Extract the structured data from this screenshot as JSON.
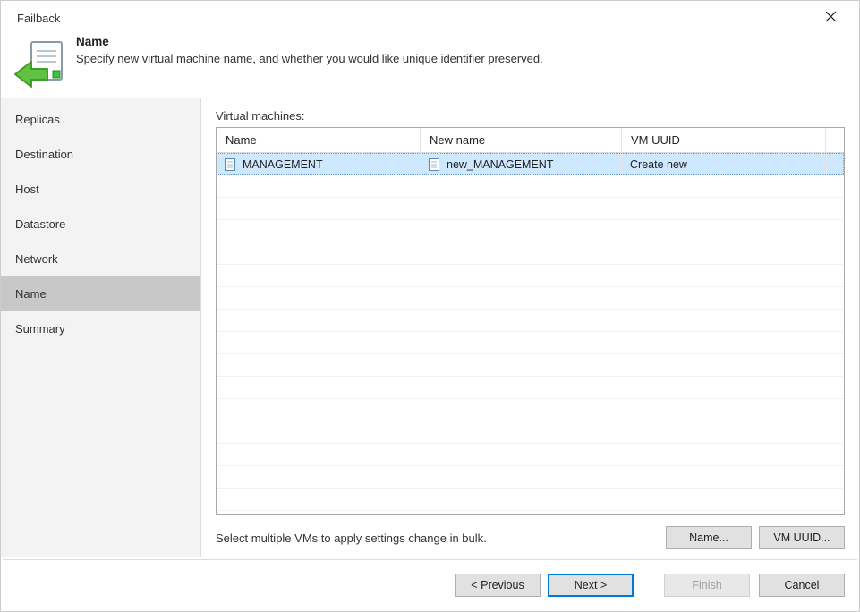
{
  "window": {
    "title": "Failback"
  },
  "header": {
    "heading": "Name",
    "subheading": "Specify new virtual machine name, and whether you would like unique identifier preserved."
  },
  "sidebar": {
    "items": [
      {
        "label": "Replicas",
        "active": false
      },
      {
        "label": "Destination",
        "active": false
      },
      {
        "label": "Host",
        "active": false
      },
      {
        "label": "Datastore",
        "active": false
      },
      {
        "label": "Network",
        "active": false
      },
      {
        "label": "Name",
        "active": true
      },
      {
        "label": "Summary",
        "active": false
      }
    ]
  },
  "main": {
    "section_label": "Virtual machines:",
    "columns": {
      "c1": "Name",
      "c2": "New name",
      "c3": "VM UUID"
    },
    "rows": [
      {
        "name": "MANAGEMENT",
        "new_name": "new_MANAGEMENT",
        "uuid_mode": "Create new"
      }
    ],
    "hint": "Select multiple VMs to apply settings change in bulk.",
    "buttons": {
      "name": "Name...",
      "uuid": "VM UUID..."
    }
  },
  "footer": {
    "prev": "< Previous",
    "next": "Next >",
    "finish": "Finish",
    "cancel": "Cancel"
  }
}
